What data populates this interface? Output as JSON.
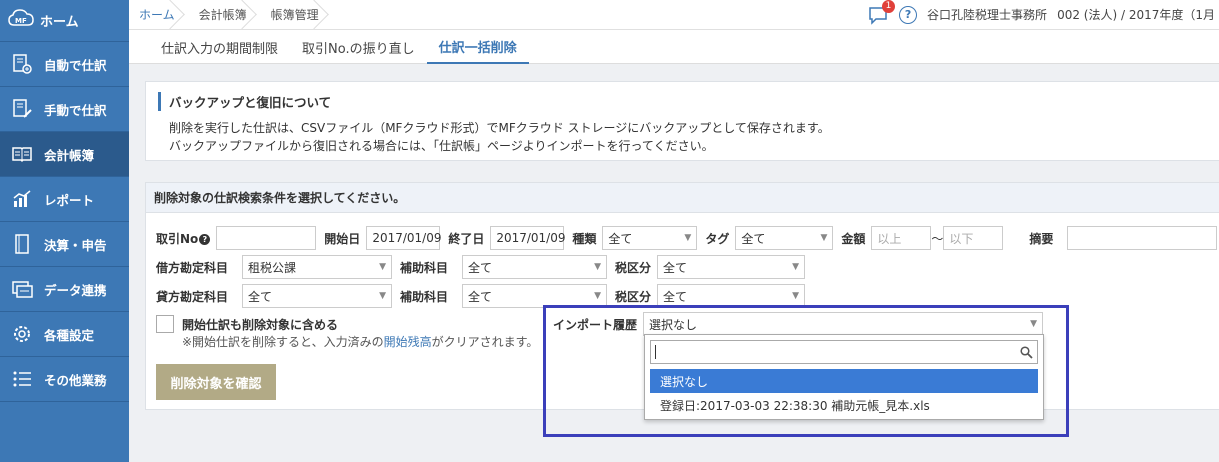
{
  "sidebar": {
    "home": "ホーム",
    "logo_text": "MF",
    "items": [
      {
        "label": "自動で仕訳",
        "icon": "auto-journal-icon"
      },
      {
        "label": "手動で仕訳",
        "icon": "manual-journal-icon"
      },
      {
        "label": "会計帳簿",
        "icon": "book-icon"
      },
      {
        "label": "レポート",
        "icon": "report-chart-icon"
      },
      {
        "label": "決算・申告",
        "icon": "settlement-icon"
      },
      {
        "label": "データ連携",
        "icon": "data-link-icon"
      },
      {
        "label": "各種設定",
        "icon": "gear-icon"
      },
      {
        "label": "その他業務",
        "icon": "list-icon"
      }
    ],
    "active_index": 2
  },
  "header": {
    "breadcrumbs": [
      "ホーム",
      "会計帳簿",
      "帳簿管理"
    ],
    "notification_count": "1",
    "help": "?",
    "office": "谷口孔陸税理士事務所",
    "client": "002 (法人) / 2017年度（1月"
  },
  "subtabs": [
    "仕訳入力の期間制限",
    "取引No.の振り直し",
    "仕訳一括削除"
  ],
  "info": {
    "title": "バックアップと復旧について",
    "line1": "削除を実行した仕訳は、CSVファイル（MFクラウド形式）でMFクラウド ストレージにバックアップとして保存されます。",
    "line2": "バックアップファイルから復旧される場合には、「仕訳帳」ページよりインポートを行ってください。"
  },
  "search": {
    "heading": "削除対象の仕訳検索条件を選択してください。",
    "trade_no_label": "取引No",
    "start_label": "開始日",
    "start_value": "2017/01/09",
    "end_label": "終了日",
    "end_value": "2017/01/09",
    "kind_label": "種類",
    "kind_value": "全て",
    "tag_label": "タグ",
    "tag_value": "全て",
    "amount_label": "金額",
    "amount_min_ph": "以上",
    "amount_sep": "〜",
    "amount_max_ph": "以下",
    "memo_label": "摘要",
    "debit_label": "借方勘定科目",
    "debit_value": "租税公課",
    "sub_label": "補助科目",
    "sub_value": "全て",
    "tax_label": "税区分",
    "tax_value": "全て",
    "credit_label": "貸方勘定科目",
    "credit_value": "全て",
    "sub2_value": "全て",
    "tax2_value": "全て",
    "include_opening": "開始仕訳も削除対象に含める",
    "note_pre": "※開始仕訳を削除すると、入力済みの",
    "note_link": "開始残高",
    "note_post": "がクリアされます。",
    "import_label": "インポート履歴",
    "import_value": "選択なし",
    "confirm_button": "削除対象を確認"
  },
  "dropdown": {
    "search_value": "",
    "options": [
      "選択なし",
      "登録日:2017-03-03 22:38:30 補助元帳_見本.xls"
    ],
    "selected_index": 0
  },
  "colors": {
    "sidebar": "#3d78b5",
    "accent": "#3d78b5",
    "highlight": "#3b3fba",
    "selected_option": "#3a7bd5",
    "confirm_button": "#b2aa86"
  }
}
